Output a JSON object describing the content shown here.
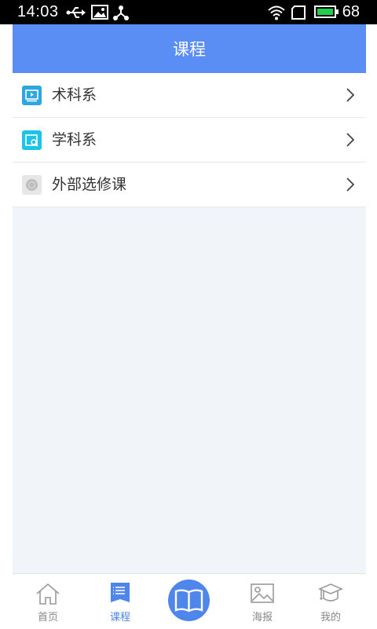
{
  "status_bar": {
    "time": "14:03",
    "battery_level": "68",
    "icons": [
      "usb-icon",
      "image-icon",
      "share-icon",
      "wifi-icon",
      "sim-icon",
      "battery-icon"
    ]
  },
  "header": {
    "title": "课程"
  },
  "list": {
    "items": [
      {
        "label": "术科系",
        "icon": "video-icon"
      },
      {
        "label": "学科系",
        "icon": "search-box-icon"
      },
      {
        "label": "外部选修课",
        "icon": "gray-circle-icon"
      }
    ]
  },
  "tabbar": {
    "tabs": [
      {
        "label": "首页",
        "icon": "home-icon"
      },
      {
        "label": "课程",
        "icon": "course-list-icon"
      },
      {
        "label": "",
        "icon": "book-icon"
      },
      {
        "label": "海报",
        "icon": "picture-icon"
      },
      {
        "label": "我的",
        "icon": "graduation-cap-icon"
      }
    ],
    "active_index": 1
  },
  "colors": {
    "accent": "#5a8ef5",
    "background": "#f1f5fa",
    "active": "#4f86ec"
  }
}
